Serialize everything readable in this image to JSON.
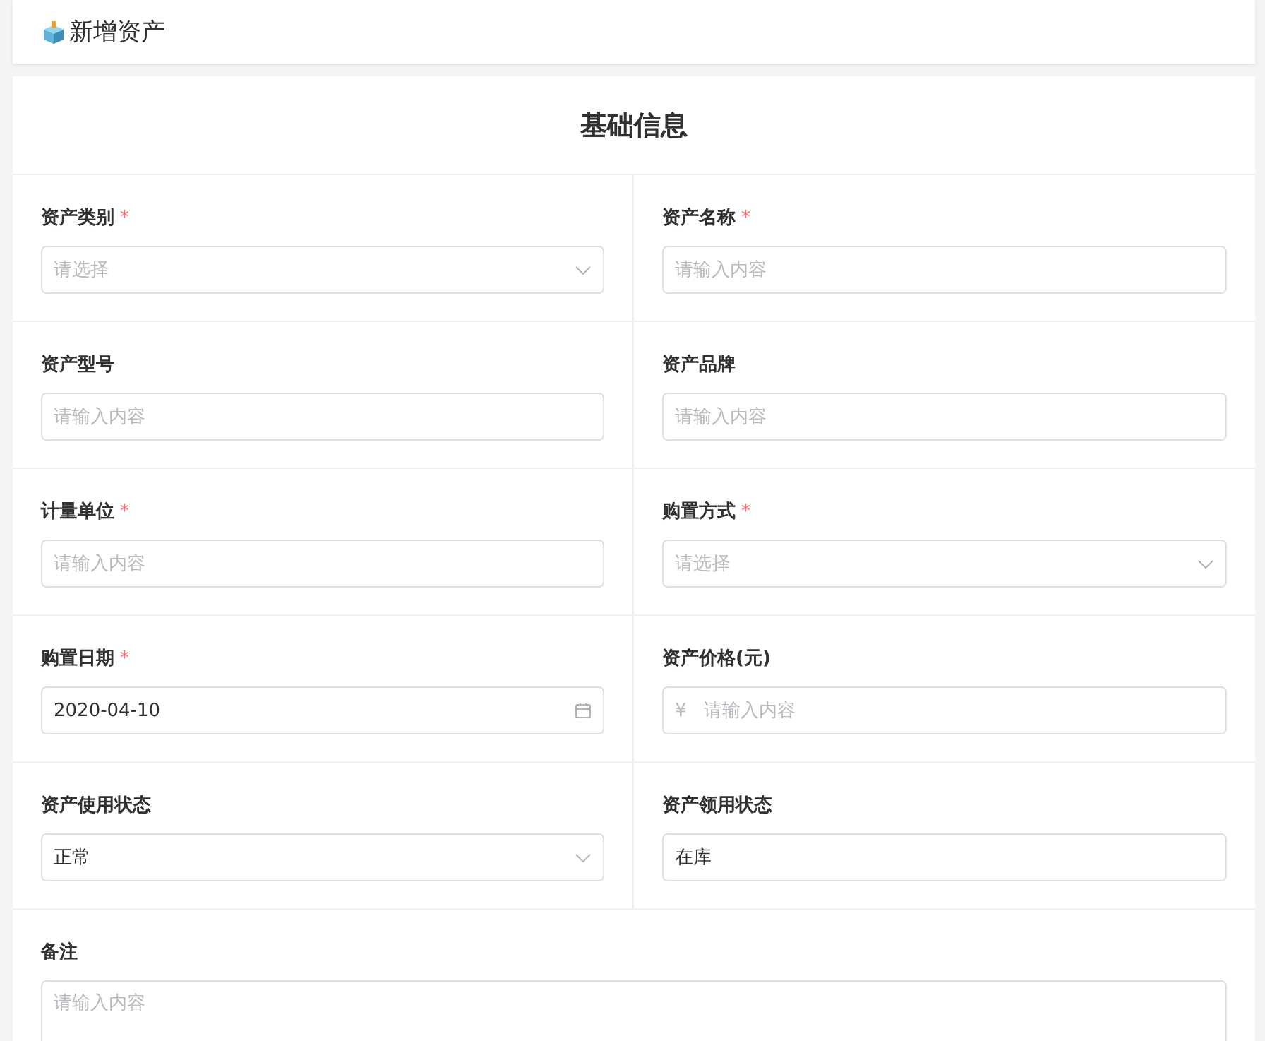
{
  "page": {
    "title": "新增资产"
  },
  "form": {
    "section_title": "基础信息",
    "fields": [
      {
        "label": "资产类别",
        "required_mark": "*",
        "kind": "select",
        "placeholder": "请选择"
      },
      {
        "label": "资产名称",
        "required_mark": "*",
        "kind": "input",
        "placeholder": "请输入内容"
      },
      {
        "label": "资产型号",
        "kind": "input",
        "placeholder": "请输入内容"
      },
      {
        "label": "资产品牌",
        "kind": "input",
        "placeholder": "请输入内容"
      },
      {
        "label": "计量单位",
        "required_mark": "*",
        "kind": "input",
        "placeholder": "请输入内容"
      },
      {
        "label": "购置方式",
        "required_mark": "*",
        "kind": "select",
        "placeholder": "请选择"
      },
      {
        "label": "购置日期",
        "required_mark": "*",
        "kind": "date",
        "value": "2020-04-10"
      },
      {
        "label": "资产价格(元)",
        "kind": "money",
        "prefix": "¥",
        "placeholder": "请输入内容"
      },
      {
        "label": "资产使用状态",
        "kind": "select",
        "value": "正常"
      },
      {
        "label": "资产领用状态",
        "kind": "input",
        "value": "在库"
      },
      {
        "label": "备注",
        "kind": "textarea",
        "placeholder": "请输入内容"
      }
    ]
  }
}
